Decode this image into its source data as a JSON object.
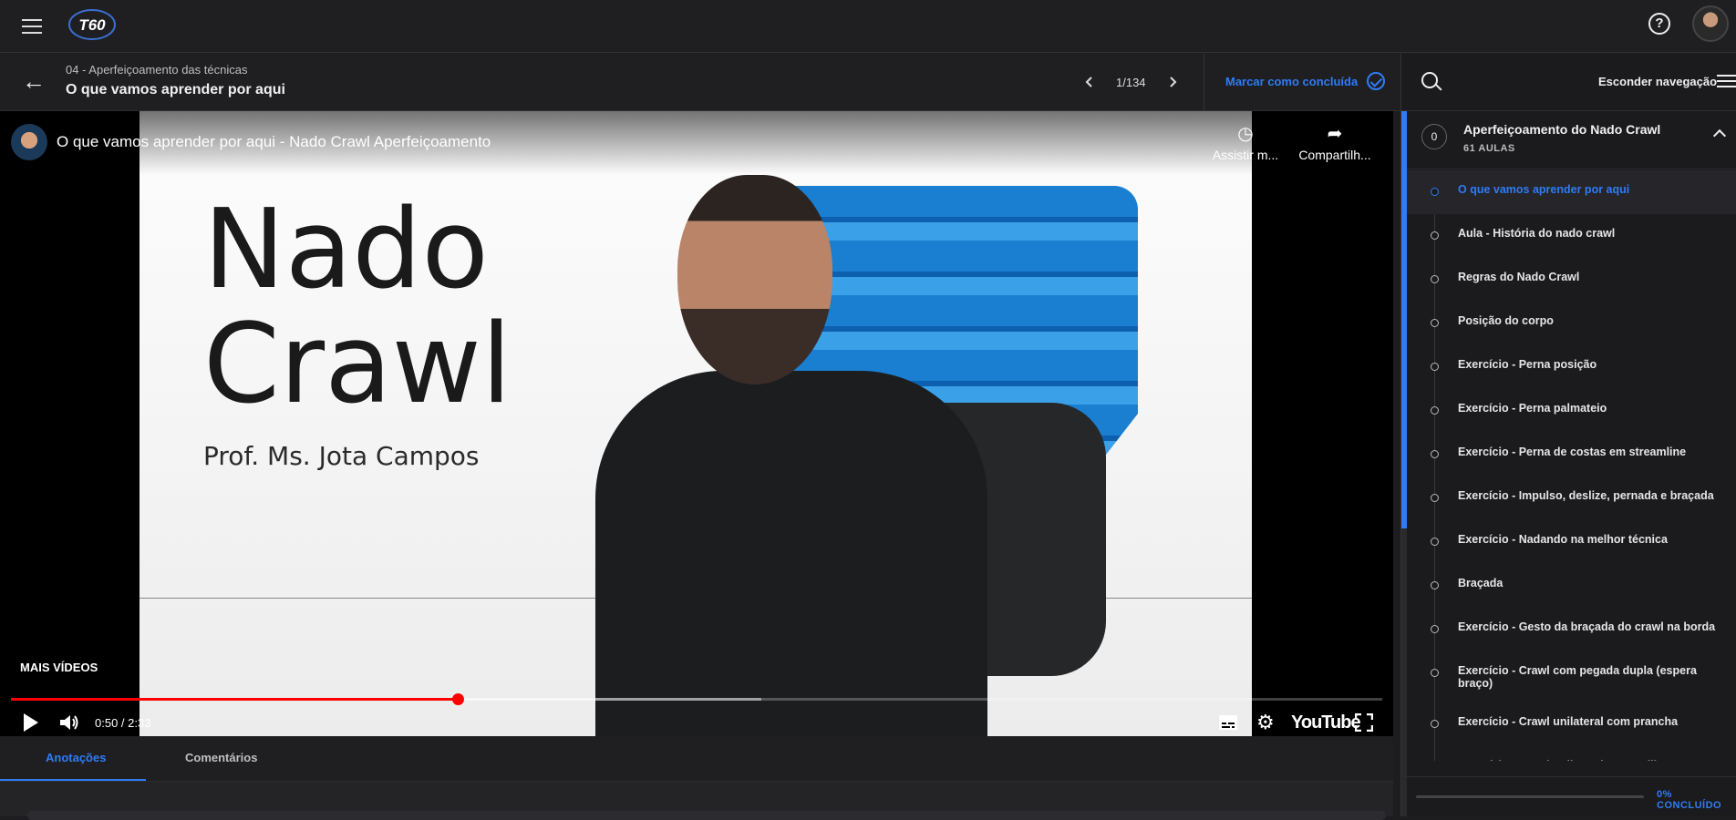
{
  "app": {
    "logo_text": "T60"
  },
  "header": {
    "module_name": "04 - Aperfeiçoamento das técnicas",
    "lesson_title": "O que vamos aprender por aqui",
    "pager": "1/134",
    "mark_complete_label": "Marcar como concluída"
  },
  "video": {
    "title": "O que vamos aprender por aqui - Nado Crawl Aperfeiçoamento",
    "watch_later_label": "Assistir m...",
    "share_label": "Compartilh...",
    "slide_title_line1": "Nado",
    "slide_title_line2": "Crawl",
    "slide_professor": "Prof. Ms. Jota Campos",
    "more_videos_label": "MAIS VÍDEOS",
    "time_display": "0:50 / 2:33",
    "progress_played": 0.326,
    "progress_buffered": 0.547,
    "youtube_label": "YouTube"
  },
  "tabs": [
    {
      "label": "Anotações",
      "active": true
    },
    {
      "label": "Comentários",
      "active": false
    }
  ],
  "sidebar": {
    "hide_nav_label": "Esconder navegação",
    "section": {
      "number": "0",
      "title": "Aperfeiçoamento do Nado Crawl",
      "count": "61 AULAS"
    },
    "lessons": [
      "O que vamos aprender por aqui",
      "Aula - História do nado crawl",
      "Regras do Nado Crawl",
      "Posição do corpo",
      "Exercício - Perna posição",
      "Exercício - Perna palmateio",
      "Exercício - Perna de costas em streamline",
      "Exercício - Impulso, deslize, pernada e braçada",
      "Exercício - Nadando na melhor técnica",
      "Braçada",
      "Exercício - Gesto da braçada do crawl na borda",
      "Exercício - Crawl com pegada dupla (espera braço)",
      "Exercício - Crawl unilateral com prancha",
      "Exercício - Crawl unilateral com pullbuoy"
    ],
    "progress_label": "0% CONCLUÍDO",
    "progress_value": 0
  },
  "colors": {
    "accent": "#2f7cf6",
    "background": "#1d1d20",
    "video_progress": "#ff0000"
  }
}
